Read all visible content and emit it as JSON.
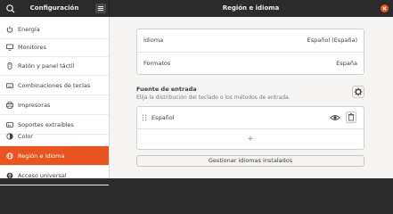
{
  "window": {
    "sidebar_title": "Configuración",
    "main_title": "Región e idioma",
    "accent": "#e95420"
  },
  "sidebar": {
    "items": [
      {
        "label": "Energía",
        "icon": "power-icon"
      },
      {
        "label": "Monitores",
        "icon": "display-icon"
      },
      {
        "label": "Ratón y panel táctil",
        "icon": "mouse-icon"
      },
      {
        "label": "Combinaciones de teclas",
        "icon": "keyboard-icon"
      },
      {
        "label": "Impresoras",
        "icon": "printer-icon"
      },
      {
        "label": "Soportes extraíbles",
        "icon": "media-icon"
      },
      {
        "label": "Color",
        "icon": "color-icon"
      },
      {
        "label": "Región e idioma",
        "icon": "globe-icon",
        "active": true
      },
      {
        "label": "Acceso universal",
        "icon": "accessibility-icon"
      }
    ]
  },
  "region": {
    "language_key": "Idioma",
    "language_value": "Español (España)",
    "formats_key": "Formatos",
    "formats_value": "España"
  },
  "input_sources": {
    "title": "Fuente de entrada",
    "subtitle": "Elija la distribución del teclado o los métodos de entrada.",
    "items": [
      {
        "label": "Español"
      }
    ],
    "add_label": "+",
    "manage_label": "Gestionar idiomas instalados"
  }
}
